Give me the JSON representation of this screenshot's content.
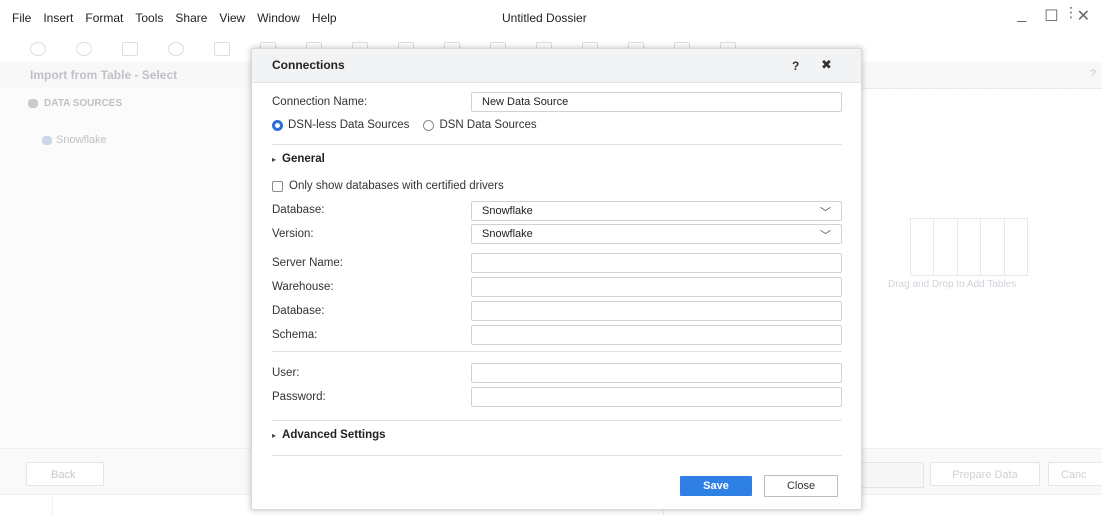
{
  "menubar": {
    "items": [
      "File",
      "Insert",
      "Format",
      "Tools",
      "Share",
      "View",
      "Window",
      "Help"
    ],
    "document_title": "Untitled Dossier"
  },
  "window_controls": {
    "minimize": "_",
    "maximize": "☐",
    "close": "✕"
  },
  "background_dialog": {
    "title": "Import from Table - Select",
    "help": "?",
    "data_sources_heading": "DATA SOURCES",
    "data_source_item": "Snowflake",
    "drag_drop_text": "Drag and Drop to Add Tables",
    "back_label": "Back",
    "prepare_data_label": "Prepare Data",
    "cancel_label": "Canc"
  },
  "dialog": {
    "title": "Connections",
    "help_label": "?",
    "close_symbol": "✖",
    "connection_name_label": "Connection Name:",
    "connection_name_value": "New Data Source",
    "radio_dsnless": "DSN-less Data Sources",
    "radio_dsn": "DSN Data Sources",
    "radio_selected": "dsn-less",
    "general_section": "General",
    "certified_drivers_label": "Only show databases with certified drivers",
    "certified_drivers_checked": false,
    "database_label": "Database:",
    "database_value": "Snowflake",
    "version_label": "Version:",
    "version_value": "Snowflake",
    "server_name_label": "Server Name:",
    "server_name_value": "",
    "warehouse_label": "Warehouse:",
    "warehouse_value": "",
    "database2_label": "Database:",
    "database2_value": "",
    "schema_label": "Schema:",
    "schema_value": "",
    "user_label": "User:",
    "user_value": "",
    "password_label": "Password:",
    "password_value": "",
    "advanced_section": "Advanced Settings",
    "save_label": "Save",
    "close_label": "Close"
  },
  "colors": {
    "accent": "#2f80e4",
    "radio_selected": "#2d6fd6",
    "dialog_header": "#f2f3f5"
  },
  "icons": {
    "chevron": "chevron-down-icon",
    "triangle": "expand-triangle-icon"
  }
}
